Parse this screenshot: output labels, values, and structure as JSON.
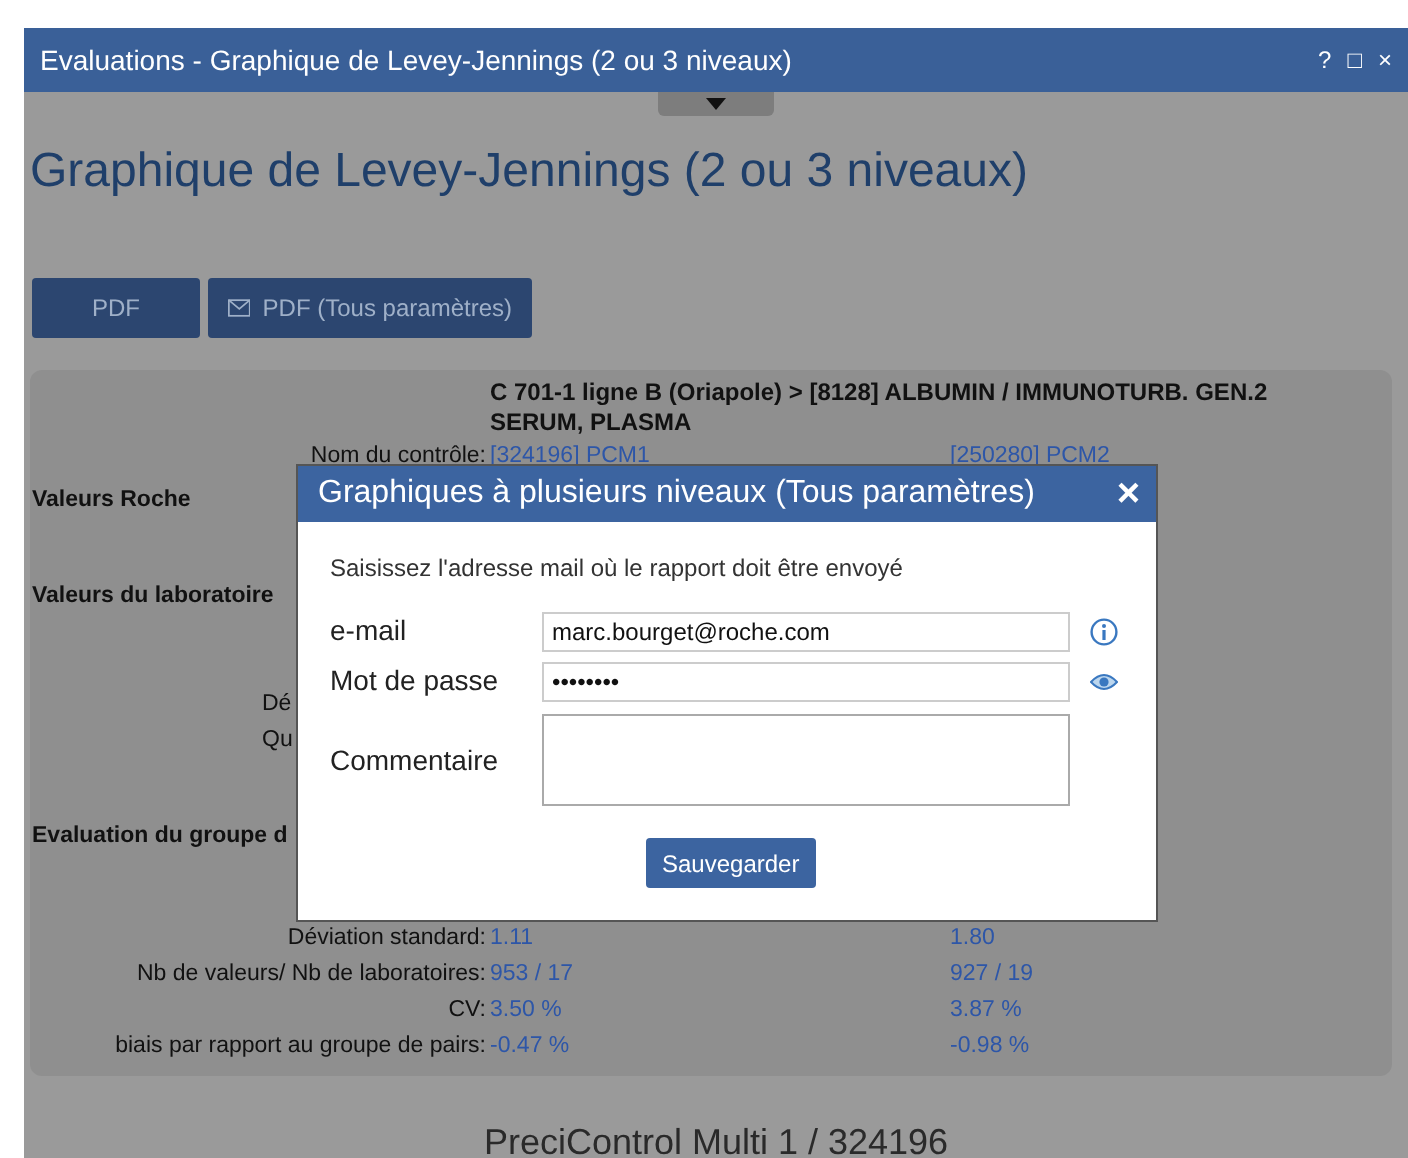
{
  "window": {
    "title": "Evaluations - Graphique de Levey-Jennings (2 ou 3 niveaux)",
    "controls": [
      "?",
      "□",
      "×"
    ]
  },
  "heading": "Graphique de Levey-Jennings (2 ou 3 niveaux)",
  "buttons": [
    {
      "label": "PDF",
      "icon": false
    },
    {
      "label": "PDF (Tous paramètres)",
      "icon": true
    }
  ],
  "panel": {
    "title": "C 701-1 ligne B (Oriapole) > [8128] ALBUMIN / IMMUNOTURB. GEN.2 SERUM, PLASMA",
    "rows": [
      {
        "kind": "pair",
        "label": "Nom du contrôle:",
        "values": [
          "[324196] PCM1",
          "[250280] PCM2"
        ]
      },
      {
        "kind": "section",
        "label": "Valeurs Roche"
      },
      {
        "kind": "section",
        "label": "Valeurs du laboratoire"
      },
      {
        "kind": "partial",
        "label": "Dé"
      },
      {
        "kind": "partial",
        "label": "Qu"
      },
      {
        "kind": "section",
        "label": "Evaluation du groupe d"
      },
      {
        "kind": "pair",
        "label": "Déviation standard:",
        "values": [
          "1.11",
          "1.80"
        ]
      },
      {
        "kind": "pair",
        "label": "Nb de valeurs/ Nb de laboratoires:",
        "values": [
          "953 / 17",
          "927 / 19"
        ]
      },
      {
        "kind": "pair",
        "label": "CV:",
        "values": [
          "3.50 %",
          "3.87 %"
        ]
      },
      {
        "kind": "pair",
        "label": "biais par rapport au groupe de pairs:",
        "values": [
          "-0.47 %",
          "-0.98 %"
        ]
      }
    ]
  },
  "footer": "PreciControl Multi 1 / 324196",
  "dialog": {
    "title": "Graphiques à plusieurs niveaux (Tous paramètres)",
    "close": "×",
    "instruction": "Saisissez l'adresse mail où le rapport doit être envoyé",
    "fields": [
      {
        "kind": "email",
        "label": "e-mail",
        "value": "marc.bourget@roche.com"
      },
      {
        "kind": "password",
        "label": "Mot de passe",
        "value": "••••••••"
      },
      {
        "kind": "textarea",
        "label": "Commentaire"
      }
    ],
    "save": "Sauvegarder"
  }
}
